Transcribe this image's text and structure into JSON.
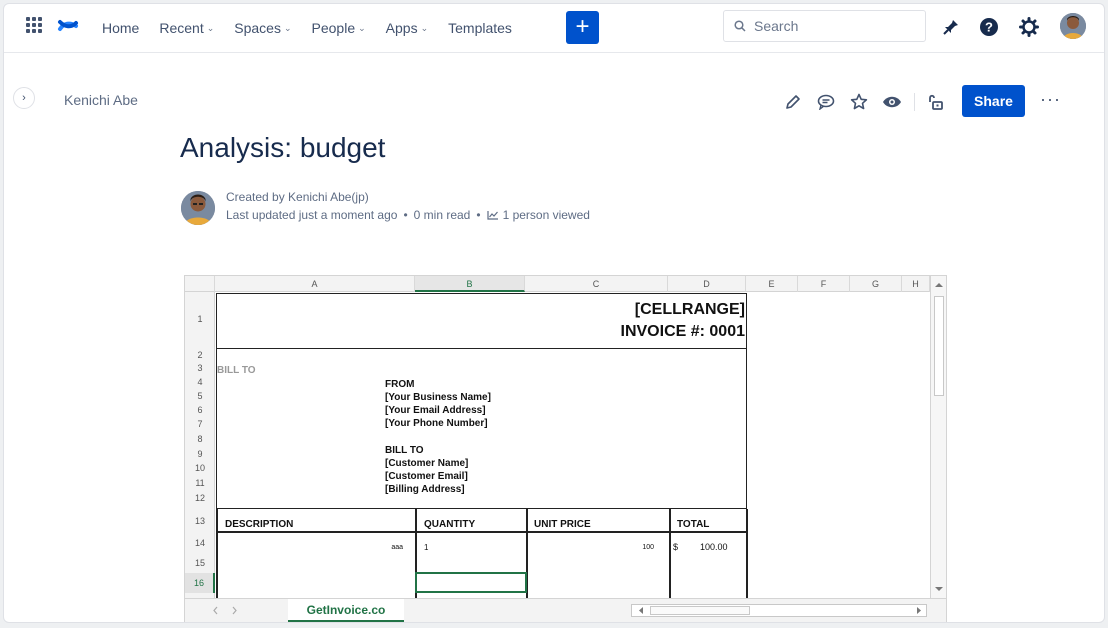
{
  "nav": {
    "items": [
      {
        "label": "Home",
        "dropdown": false
      },
      {
        "label": "Recent",
        "dropdown": true
      },
      {
        "label": "Spaces",
        "dropdown": true
      },
      {
        "label": "People",
        "dropdown": true
      },
      {
        "label": "Apps",
        "dropdown": true
      },
      {
        "label": "Templates",
        "dropdown": false
      }
    ],
    "create_label": "+",
    "search_placeholder": "Search"
  },
  "breadcrumb": "Kenichi Abe",
  "toolbar": {
    "share_label": "Share",
    "more_label": "···"
  },
  "page": {
    "title": "Analysis: budget",
    "created_by": "Created by Kenichi Abe(jp)",
    "last_updated": "Last updated just a moment ago",
    "read_time": "0 min read",
    "views": "1 person viewed"
  },
  "sheet": {
    "columns": [
      "A",
      "B",
      "C",
      "D",
      "E",
      "F",
      "G",
      "H"
    ],
    "rows": [
      "1",
      "2",
      "3",
      "4",
      "5",
      "6",
      "7",
      "8",
      "9",
      "10",
      "11",
      "12",
      "13",
      "14",
      "15",
      "16"
    ],
    "cellrange": "[CELLRANGE]",
    "invoice_no": "INVOICE #: 0001",
    "bill_to_top": "BILL TO",
    "from": "FROM",
    "business_name": "[Your Business Name]",
    "email": "[Your Email Address]",
    "phone": "[Your Phone Number]",
    "bill_to": "BILL TO",
    "customer_name": "[Customer Name]",
    "customer_email": "[Customer Email]",
    "billing_address": "[Billing Address]",
    "headers": {
      "description": "DESCRIPTION",
      "quantity": "QUANTITY",
      "unit_price": "UNIT PRICE",
      "total": "TOTAL"
    },
    "row14": {
      "description": "aaa",
      "quantity": "1",
      "unit_price": "100",
      "currency": "$",
      "total": "100.00"
    },
    "tab_name": "GetInvoice.co"
  }
}
